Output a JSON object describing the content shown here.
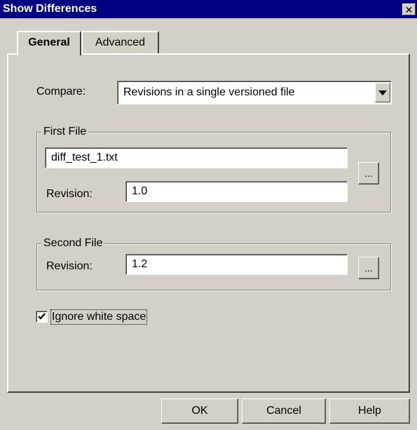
{
  "window": {
    "title": "Show Differences",
    "close_glyph": "✕"
  },
  "tabs": [
    {
      "label": "General",
      "active": true
    },
    {
      "label": "Advanced",
      "active": false
    }
  ],
  "compare": {
    "label": "Compare:",
    "value": "Revisions in a single versioned file"
  },
  "first_file": {
    "group_label": "First File",
    "file_value": "diff_test_1.txt",
    "revision_label": "Revision:",
    "revision_value": "1.0",
    "browse_label": "..."
  },
  "second_file": {
    "group_label": "Second File",
    "revision_label": "Revision:",
    "revision_value": "1.2",
    "browse_label": "..."
  },
  "ignore_whitespace": {
    "label": "Ignore white space",
    "checked": true
  },
  "buttons": {
    "ok": "OK",
    "cancel": "Cancel",
    "help": "Help"
  },
  "icons": {
    "close": "close-icon",
    "dropdown": "chevron-down-icon",
    "check": "checkmark-icon"
  }
}
